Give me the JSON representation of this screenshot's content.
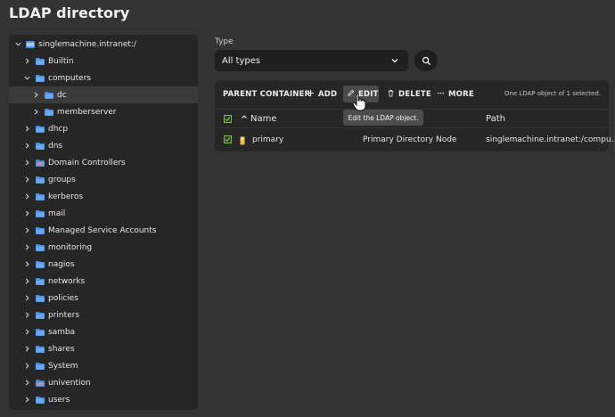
{
  "page": {
    "title": "LDAP directory"
  },
  "tree": {
    "root": "singlemachine.intranet:/",
    "items": [
      {
        "label": "Builtin",
        "level": 1,
        "expanded": false,
        "icon": "container-icon"
      },
      {
        "label": "computers",
        "level": 1,
        "expanded": true,
        "icon": "container-icon"
      },
      {
        "label": "dc",
        "level": 2,
        "expanded": false,
        "icon": "container-icon",
        "selected": true
      },
      {
        "label": "memberserver",
        "level": 2,
        "expanded": false,
        "icon": "container-icon"
      },
      {
        "label": "dhcp",
        "level": 1,
        "expanded": false,
        "icon": "container-icon"
      },
      {
        "label": "dns",
        "level": 1,
        "expanded": false,
        "icon": "container-icon"
      },
      {
        "label": "Domain Controllers",
        "level": 1,
        "expanded": false,
        "icon": "ou-icon"
      },
      {
        "label": "groups",
        "level": 1,
        "expanded": false,
        "icon": "container-icon"
      },
      {
        "label": "kerberos",
        "level": 1,
        "expanded": false,
        "icon": "container-icon"
      },
      {
        "label": "mail",
        "level": 1,
        "expanded": false,
        "icon": "container-icon"
      },
      {
        "label": "Managed Service Accounts",
        "level": 1,
        "expanded": false,
        "icon": "container-icon"
      },
      {
        "label": "monitoring",
        "level": 1,
        "expanded": false,
        "icon": "container-icon"
      },
      {
        "label": "nagios",
        "level": 1,
        "expanded": false,
        "icon": "container-icon"
      },
      {
        "label": "networks",
        "level": 1,
        "expanded": false,
        "icon": "container-icon"
      },
      {
        "label": "policies",
        "level": 1,
        "expanded": false,
        "icon": "container-icon"
      },
      {
        "label": "printers",
        "level": 1,
        "expanded": false,
        "icon": "container-icon"
      },
      {
        "label": "samba",
        "level": 1,
        "expanded": false,
        "icon": "container-icon"
      },
      {
        "label": "shares",
        "level": 1,
        "expanded": false,
        "icon": "container-icon"
      },
      {
        "label": "System",
        "level": 1,
        "expanded": false,
        "icon": "container-icon"
      },
      {
        "label": "univention",
        "level": 1,
        "expanded": false,
        "icon": "ou-icon"
      },
      {
        "label": "users",
        "level": 1,
        "expanded": false,
        "icon": "container-icon"
      }
    ]
  },
  "filter": {
    "type_label": "Type",
    "type_value": "All types"
  },
  "toolbar": {
    "parent_container": "PARENT CONTAINER",
    "add": "ADD",
    "edit": "EDIT",
    "delete": "DELETE",
    "more": "MORE",
    "status": "One LDAP object of 1 selected."
  },
  "tooltip": "Edit the LDAP object.",
  "grid": {
    "columns": [
      "Name",
      "",
      "Path"
    ],
    "rows": [
      {
        "name": "primary",
        "type": "Primary Directory Node",
        "path": "singlemachine.intranet:/compu..."
      }
    ]
  },
  "colors": {
    "background": "#333333",
    "panel": "#262626",
    "folder": "#4a90e2",
    "check": "#7fbf3f"
  }
}
